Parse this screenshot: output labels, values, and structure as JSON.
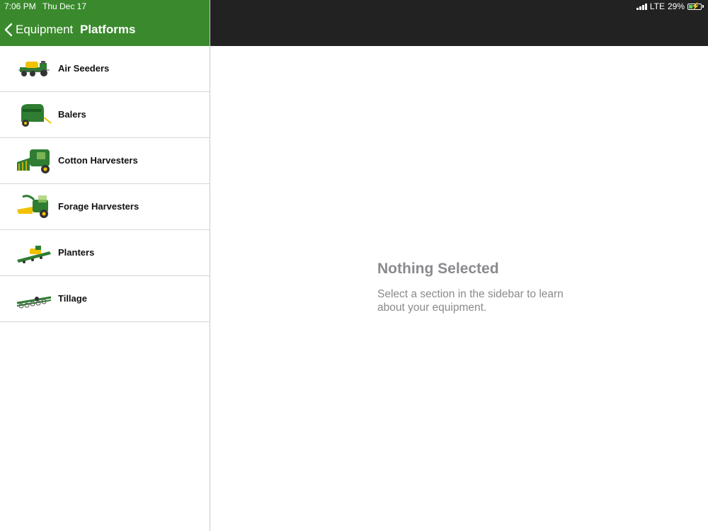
{
  "status_bar": {
    "time": "7:06 PM",
    "date": "Thu Dec 17",
    "network": "LTE",
    "battery": "29%",
    "battery_level": 0.29
  },
  "nav": {
    "back_label": "Equipment",
    "title": "Platforms"
  },
  "platforms": [
    {
      "label": "Air Seeders",
      "icon": "air-seeder-icon"
    },
    {
      "label": "Balers",
      "icon": "baler-icon"
    },
    {
      "label": "Cotton Harvesters",
      "icon": "cotton-harvester-icon"
    },
    {
      "label": "Forage Harvesters",
      "icon": "forage-harvester-icon"
    },
    {
      "label": "Planters",
      "icon": "planter-icon"
    },
    {
      "label": "Tillage",
      "icon": "tillage-icon"
    }
  ],
  "detail": {
    "title": "Nothing Selected",
    "message": "Select a section in the sidebar to learn about your equipment."
  },
  "colors": {
    "brand_green": "#3a8a2d",
    "machine_green": "#2e7d32",
    "machine_yellow": "#f2c200",
    "dark_header": "#222222",
    "empty_text": "#8a8a8e"
  }
}
